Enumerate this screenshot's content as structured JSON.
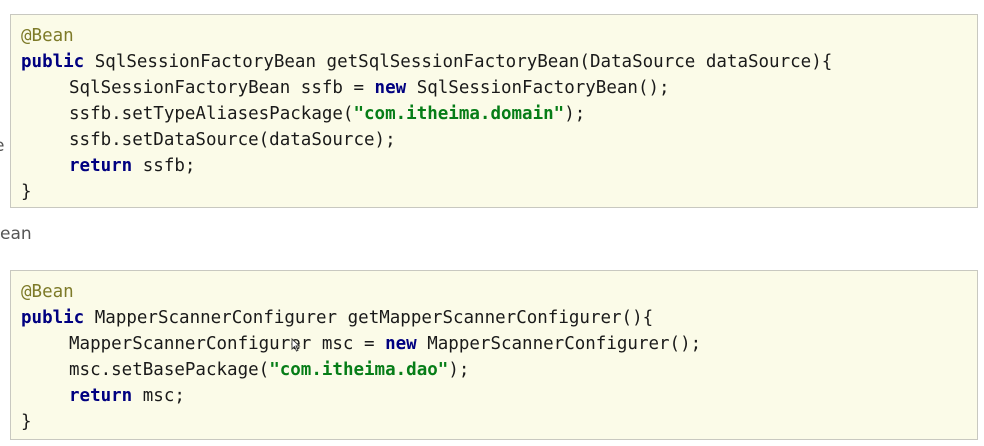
{
  "side_labels": {
    "left_fragment_1": "e",
    "left_fragment_2": "ean"
  },
  "block1": {
    "annotation": "@Bean",
    "line1": {
      "kw": "public",
      "rest": " SqlSessionFactoryBean getSqlSessionFactoryBean(DataSource dataSource){"
    },
    "line2": {
      "pre": "SqlSessionFactoryBean ssfb = ",
      "kw": "new",
      "post": " SqlSessionFactoryBean();"
    },
    "line3": {
      "pre": "ssfb.setTypeAliasesPackage(",
      "str": "\"com.itheima.domain\"",
      "post": ");"
    },
    "line4": {
      "text": "ssfb.setDataSource(dataSource);"
    },
    "line5": {
      "kw": "return",
      "post": " ssfb;"
    },
    "close": "}"
  },
  "block2": {
    "annotation": "@Bean",
    "line1": {
      "kw": "public",
      "rest": " MapperScannerConfigurer getMapperScannerConfigurer(){"
    },
    "line2": {
      "pre": "MapperScannerConfigurer msc = ",
      "kw": "new",
      "post": " MapperScannerConfigurer();"
    },
    "line3": {
      "pre": "msc.setBasePackage(",
      "str": "\"com.itheima.dao\"",
      "post": ");"
    },
    "line4": {
      "kw": "return",
      "post": " msc;"
    },
    "close": "}"
  }
}
